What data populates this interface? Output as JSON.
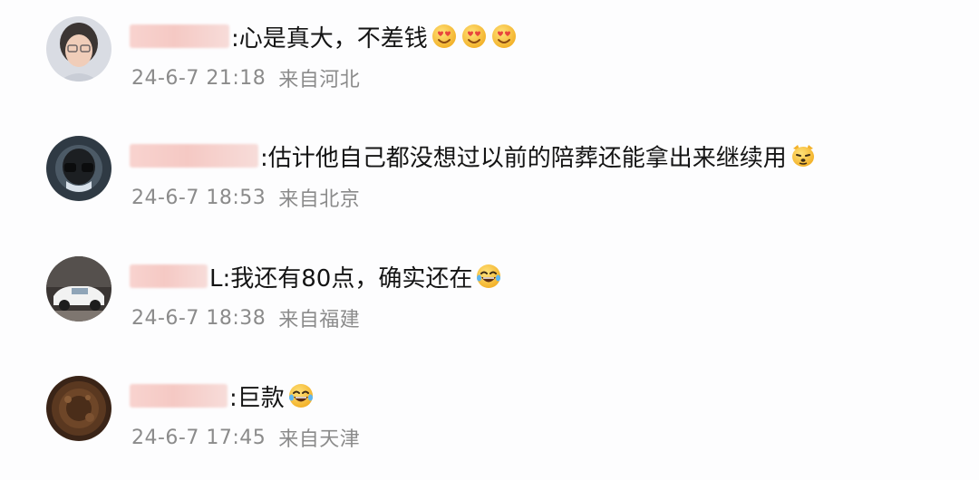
{
  "comments": [
    {
      "text": ":心是真大，不差钱",
      "time": "24-6-7 21:18",
      "location": "来自河北",
      "emojis": [
        "heart-eyes-emoji",
        "heart-eyes-emoji",
        "heart-eyes-emoji"
      ]
    },
    {
      "text": ":估计他自己都没想过以前的陪葬还能拿出来继续用",
      "time": "24-6-7 18:53",
      "location": "来自北京",
      "emojis": [
        "dog-face-emoji"
      ]
    },
    {
      "text": "L:我还有80点，确实还在",
      "time": "24-6-7 18:38",
      "location": "来自福建",
      "emojis": [
        "laughing-tears-emoji"
      ]
    },
    {
      "text": ":巨款",
      "time": "24-6-7 17:45",
      "location": "来自天津",
      "emojis": [
        "laughing-tears-emoji"
      ]
    }
  ],
  "colors": {
    "background": "#fdfdfe",
    "text": "#141414",
    "meta": "#8b8b8b",
    "name_blur": "#f6ccc7",
    "emoji": "#f8c33c"
  }
}
